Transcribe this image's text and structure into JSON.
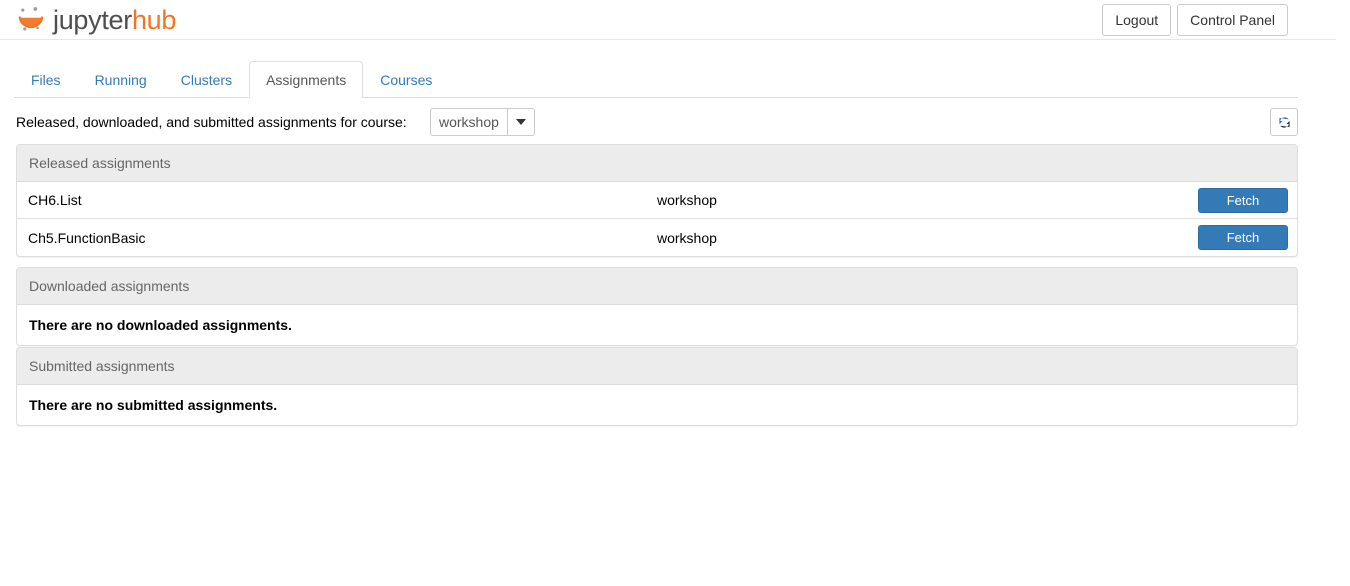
{
  "header": {
    "logo_icon": "jupyterhub-logo-icon",
    "logo_text_primary": "jupyter",
    "logo_text_accent": "hub",
    "logout_label": "Logout",
    "control_panel_label": "Control Panel",
    "accent_color": "#f37524",
    "text_color": "#4e4e4e"
  },
  "tabs": [
    {
      "label": "Files",
      "active": false
    },
    {
      "label": "Running",
      "active": false
    },
    {
      "label": "Clusters",
      "active": false
    },
    {
      "label": "Assignments",
      "active": true
    },
    {
      "label": "Courses",
      "active": false
    }
  ],
  "course_selector": {
    "label": "Released, downloaded, and submitted assignments for course:",
    "selected": "workshop",
    "caret_icon": "chevron-down-icon",
    "refresh_icon": "refresh-icon"
  },
  "panels": {
    "released": {
      "title": "Released assignments",
      "rows": [
        {
          "name": "CH6.List",
          "course": "workshop",
          "action_label": "Fetch"
        },
        {
          "name": "Ch5.FunctionBasic",
          "course": "workshop",
          "action_label": "Fetch"
        }
      ]
    },
    "downloaded": {
      "title": "Downloaded assignments",
      "empty_message": "There are no downloaded assignments."
    },
    "submitted": {
      "title": "Submitted assignments",
      "empty_message": "There are no submitted assignments."
    }
  },
  "colors": {
    "primary_button": "#337ab7",
    "link": "#337ab7",
    "panel_heading_bg": "#ececec"
  }
}
